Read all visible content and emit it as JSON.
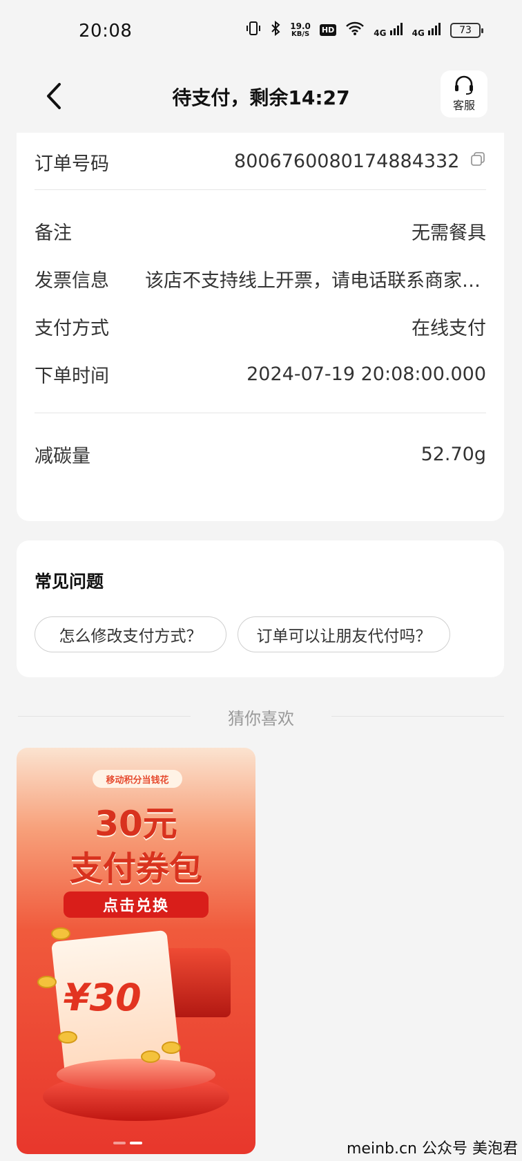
{
  "status_bar": {
    "time": "20:08",
    "speed_value": "19.0",
    "speed_unit": "KB/S",
    "hd_label": "HD",
    "net1": "4G",
    "net2": "4G",
    "battery": "73"
  },
  "header": {
    "title": "待支付，剩余14:27",
    "service_label": "客服"
  },
  "order_info": {
    "order_number_label": "订单号码",
    "order_number_value": "8006760080174884332",
    "remark_label": "备注",
    "remark_value": "无需餐具",
    "invoice_label": "发票信息",
    "invoice_value": "该店不支持线上开票，请电话联系商家开票",
    "payment_label": "支付方式",
    "payment_value": "在线支付",
    "order_time_label": "下单时间",
    "order_time_value": "2024-07-19 20:08:00.000",
    "carbon_label": "减碳量",
    "carbon_value": "52.70g"
  },
  "faq": {
    "title": "常见问题",
    "questions": [
      "怎么修改支付方式？",
      "订单可以让朋友代付吗？"
    ]
  },
  "recommend": {
    "title": "猜你喜欢",
    "promo_tag": "移动积分当钱花",
    "promo_amount": "30元",
    "promo_title": "支付券包",
    "promo_button": "点击兑换",
    "promo_ticket_amount": "¥30"
  },
  "watermark": "meinb.cn 公众号 美泡君"
}
